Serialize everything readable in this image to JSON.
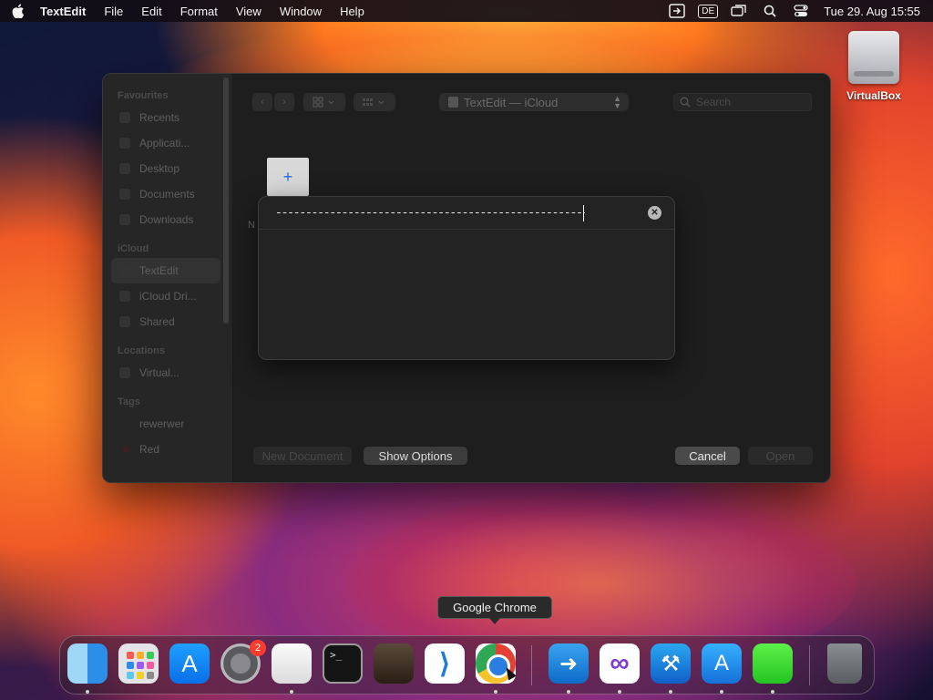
{
  "menubar": {
    "app_name": "TextEdit",
    "menus": [
      "File",
      "Edit",
      "Format",
      "View",
      "Window",
      "Help"
    ],
    "input_source": "DE",
    "clock": "Tue 29. Aug  15:55"
  },
  "desktop": {
    "items": [
      {
        "label": "VirtualBox",
        "icon": "external-disk-icon"
      }
    ]
  },
  "open_panel": {
    "sidebar": {
      "favourites_header": "Favourites",
      "favourites": [
        "Recents",
        "Applicati...",
        "Desktop",
        "Documents",
        "Downloads"
      ],
      "icloud_header": "iCloud",
      "icloud": [
        "TextEdit",
        "iCloud Dri...",
        "Shared"
      ],
      "selected": "TextEdit",
      "locations_header": "Locations",
      "locations": [
        "Virtual..."
      ],
      "tags_header": "Tags",
      "tags": [
        "rewerwer",
        "Red"
      ]
    },
    "path_popup": "TextEdit — iCloud",
    "search_placeholder": "Search",
    "partial_label": "N",
    "buttons": {
      "new_document": "New Document",
      "show_options": "Show Options",
      "cancel": "Cancel",
      "open": "Open"
    }
  },
  "go_to_folder": {
    "value": "-----------------------------------------------------"
  },
  "tooltip": "Google Chrome",
  "dock": {
    "apps": [
      "Finder",
      "Launchpad",
      "App Store",
      "System Settings",
      "TextEdit",
      "Terminal",
      "GarageBand",
      "Visual Studio Code",
      "Google Chrome",
      "Remote Desktop",
      "Visual Studio",
      "Xcode",
      "Instruments",
      "Archive Utility",
      "Trash"
    ],
    "settings_badge": "2"
  },
  "colors": {
    "window_bg": "#1e1e1e",
    "sidebar_bg": "#262626",
    "accent_blue": "#2a6ad8",
    "badge_red": "#ff3b30"
  }
}
